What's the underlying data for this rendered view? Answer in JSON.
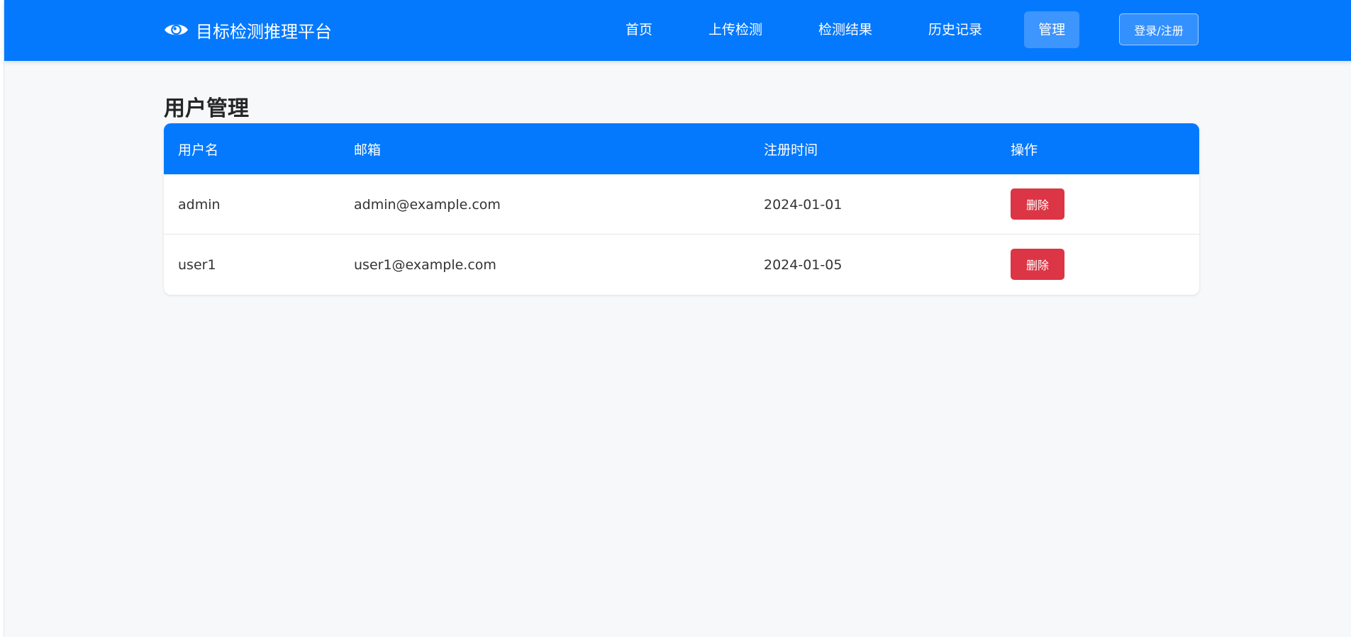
{
  "app": {
    "title": "目标检测推理平台",
    "icon": "eye-icon"
  },
  "nav": {
    "items": [
      {
        "label": "首页",
        "active": false
      },
      {
        "label": "上传检测",
        "active": false
      },
      {
        "label": "检测结果",
        "active": false
      },
      {
        "label": "历史记录",
        "active": false
      },
      {
        "label": "管理",
        "active": true
      }
    ],
    "login_label": "登录/注册"
  },
  "page": {
    "title": "用户管理"
  },
  "users_table": {
    "columns": [
      "用户名",
      "邮箱",
      "注册时间",
      "操作"
    ],
    "rows": [
      {
        "username": "admin",
        "email": "admin@example.com",
        "registered": "2024-01-01",
        "action": "删除"
      },
      {
        "username": "user1",
        "email": "user1@example.com",
        "registered": "2024-01-05",
        "action": "删除"
      }
    ]
  },
  "colors": {
    "primary": "#0479fe",
    "danger": "#dc3545",
    "background": "#f7f8fa"
  }
}
